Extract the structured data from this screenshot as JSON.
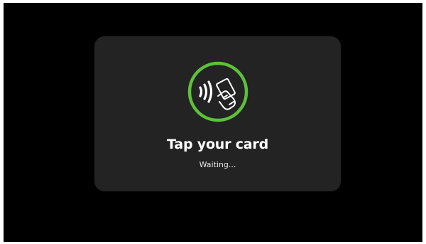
{
  "dialog": {
    "title": "Tap your card",
    "status": "Waiting..."
  },
  "icon": {
    "name": "contactless-payment-icon",
    "ring_color": "#5dc139"
  },
  "colors": {
    "backdrop": "#000000",
    "card": "#232324",
    "text": "#ffffff"
  }
}
